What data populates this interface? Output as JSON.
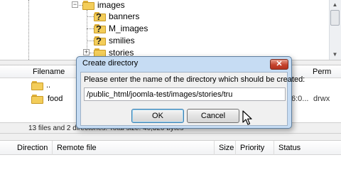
{
  "tree": {
    "items": [
      {
        "label": "images",
        "icon": "folder-icon",
        "expander": "−"
      },
      {
        "label": "banners",
        "icon": "unknown-folder-icon"
      },
      {
        "label": "M_images",
        "icon": "unknown-folder-icon"
      },
      {
        "label": "smilies",
        "icon": "unknown-folder-icon"
      },
      {
        "label": "stories",
        "icon": "folder-icon",
        "expander": "+"
      }
    ]
  },
  "filelist": {
    "columns": [
      "Filename",
      "Perm"
    ],
    "rows": [
      {
        "name": "..",
        "icon": "folder-icon"
      },
      {
        "name": "food",
        "icon": "folder-icon",
        "date_fragment": "6:0...",
        "perm": "drwx"
      }
    ]
  },
  "statusbar": {
    "text": "13 files and 2 directories. Total size: 40,320 bytes"
  },
  "queue": {
    "columns": [
      "Direction",
      "Remote file",
      "Size",
      "Priority",
      "Status"
    ]
  },
  "dialog": {
    "title": "Create directory",
    "close_label": "✕",
    "prompt": "Please enter the name of the directory which should be created:",
    "input_value": "/public_html/joomla-test/images/stories/tru",
    "ok_label": "OK",
    "cancel_label": "Cancel"
  },
  "colors": {
    "dialog_frame": "#c6dcf3",
    "close_button": "#c5432d",
    "folder": "#f3cd5a"
  }
}
